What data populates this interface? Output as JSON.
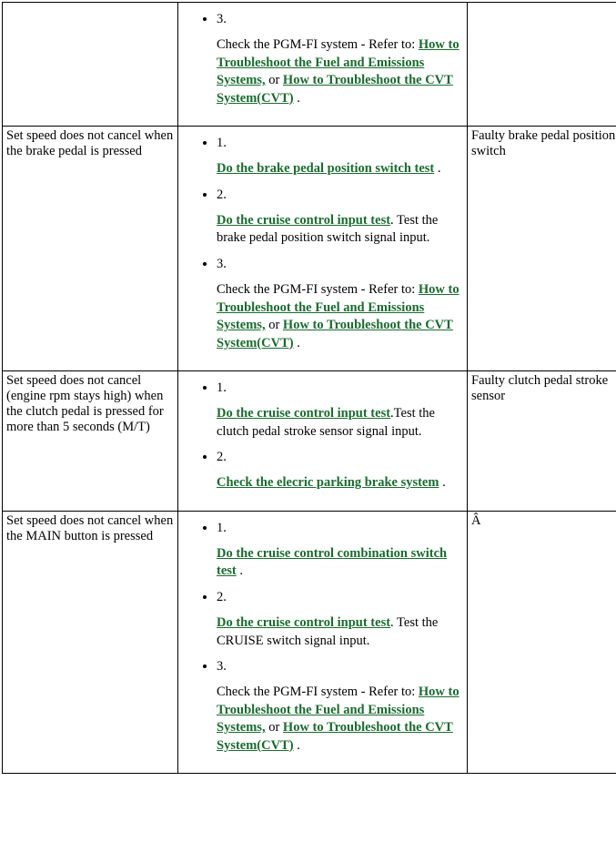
{
  "rows": [
    {
      "symptom": "",
      "cause": "",
      "steps": [
        {
          "num": "3.",
          "parts": [
            {
              "t": "text",
              "v": "Check the PGM-FI system - Refer to: "
            },
            {
              "t": "link",
              "v": "How to Troubleshoot the Fuel and Emissions Systems,"
            },
            {
              "t": "text",
              "v": " or "
            },
            {
              "t": "link",
              "v": "How to Troubleshoot the CVT System(CVT)"
            },
            {
              "t": "text",
              "v": " ."
            }
          ]
        }
      ]
    },
    {
      "symptom": "Set speed does not cancel when the brake pedal is pressed",
      "cause": "Faulty brake pedal position switch",
      "steps": [
        {
          "num": "1.",
          "parts": [
            {
              "t": "link",
              "v": "Do the brake pedal position switch test"
            },
            {
              "t": "text",
              "v": " ."
            }
          ]
        },
        {
          "num": "2.",
          "parts": [
            {
              "t": "link",
              "v": "Do the cruise control input test"
            },
            {
              "t": "text",
              "v": ". Test the brake pedal position switch signal input."
            }
          ]
        },
        {
          "num": "3.",
          "parts": [
            {
              "t": "text",
              "v": "Check the PGM-FI system - Refer to: "
            },
            {
              "t": "link",
              "v": "How to Troubleshoot the Fuel and Emissions Systems,"
            },
            {
              "t": "text",
              "v": " or "
            },
            {
              "t": "link",
              "v": "How to Troubleshoot the CVT System(CVT)"
            },
            {
              "t": "text",
              "v": " ."
            }
          ]
        }
      ]
    },
    {
      "symptom": "Set speed does not cancel (engine rpm stays high) when the clutch pedal is pressed for more than 5 seconds (M/T)",
      "cause": "Faulty clutch pedal stroke sensor",
      "steps": [
        {
          "num": "1.",
          "parts": [
            {
              "t": "link",
              "v": "Do the cruise control input test"
            },
            {
              "t": "text",
              "v": ".Test the clutch pedal stroke sensor signal input."
            }
          ]
        },
        {
          "num": "2.",
          "parts": [
            {
              "t": "link",
              "v": "Check the elecric parking brake system"
            },
            {
              "t": "text",
              "v": " ."
            }
          ]
        }
      ]
    },
    {
      "symptom": "Set speed does not cancel when the MAIN button is pressed",
      "cause": "Â ",
      "steps": [
        {
          "num": "1.",
          "parts": [
            {
              "t": "link",
              "v": "Do the cruise control combination switch test"
            },
            {
              "t": "text",
              "v": " ."
            }
          ]
        },
        {
          "num": "2.",
          "parts": [
            {
              "t": "link",
              "v": "Do the cruise control input test"
            },
            {
              "t": "text",
              "v": ". Test the CRUISE switch signal input."
            }
          ]
        },
        {
          "num": "3.",
          "parts": [
            {
              "t": "text",
              "v": "Check the PGM-FI system - Refer to: "
            },
            {
              "t": "link",
              "v": "How to Troubleshoot the Fuel and Emissions Systems,"
            },
            {
              "t": "text",
              "v": " or "
            },
            {
              "t": "link",
              "v": "How to Troubleshoot the CVT System(CVT)"
            },
            {
              "t": "text",
              "v": " ."
            }
          ]
        }
      ]
    }
  ]
}
